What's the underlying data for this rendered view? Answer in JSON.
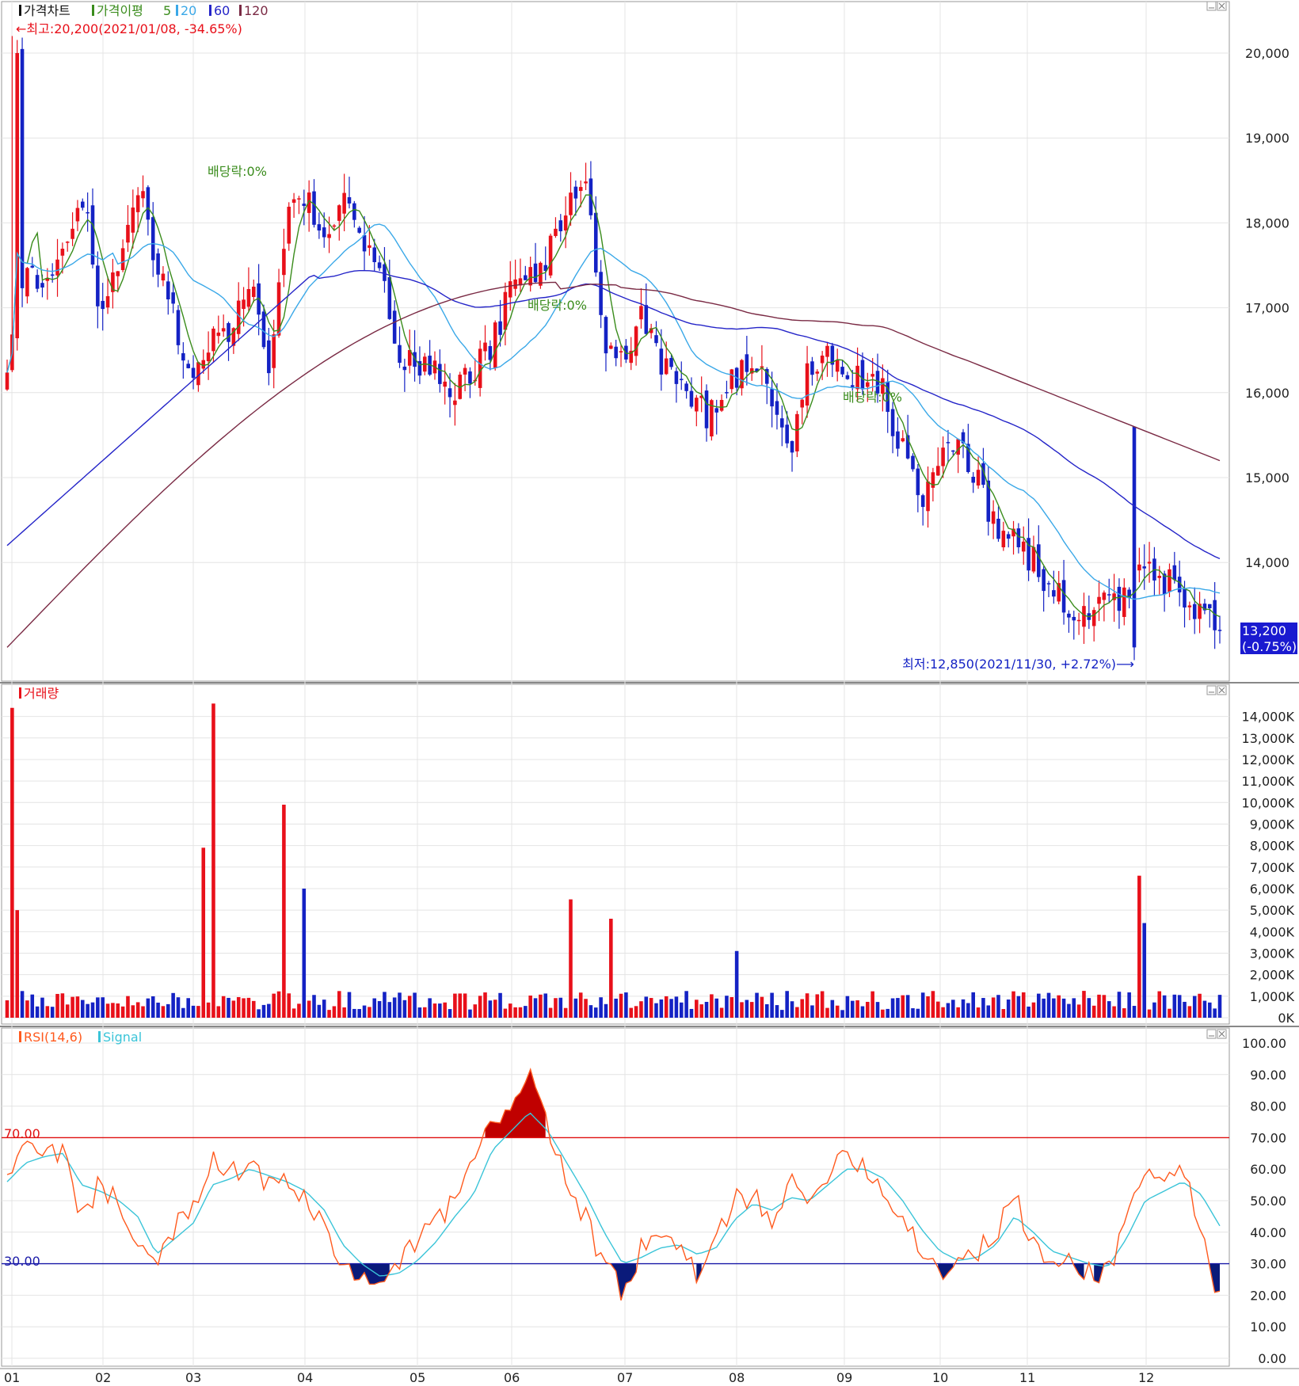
{
  "colors": {
    "up": "#e8101a",
    "down": "#1422c4",
    "ma5": "#3a8c1c",
    "ma20": "#3aa8e8",
    "ma60": "#2424c8",
    "ma120": "#7a2a44",
    "rsi": "#ff5a1e",
    "signal": "#3ac4d8",
    "overbought": "#e01010",
    "oversold": "#1a1aa8",
    "rsi_fill_high": "#c00000",
    "rsi_fill_low": "#0a1a7a",
    "grid": "#e4e4e4",
    "panel_border": "#9a9a9a",
    "last_price_box": "#1a1ad0"
  },
  "price_panel": {
    "legend_title": "가격차트",
    "legend_ma_label": "가격이평",
    "ma_periods": [
      "5",
      "20",
      "60",
      "120"
    ],
    "high_annotation": "←최고:20,200(2021/01/08, -34.65%)",
    "low_annotation": "최저:12,850(2021/11/30, +2.72%)⟶",
    "last_price": "13,200",
    "last_change": "(-0.75%)",
    "y_ticks": [
      "20,000",
      "19,000",
      "18,000",
      "17,000",
      "16,000",
      "15,000",
      "14,000"
    ],
    "dividend_labels": [
      "배당락:0%",
      "배당락:0%",
      "배당락:0%"
    ]
  },
  "volume_panel": {
    "legend": "거래량",
    "y_ticks": [
      "14,000K",
      "13,000K",
      "12,000K",
      "11,000K",
      "10,000K",
      "9,000K",
      "8,000K",
      "7,000K",
      "6,000K",
      "5,000K",
      "4,000K",
      "3,000K",
      "2,000K",
      "1,000K",
      "0K"
    ]
  },
  "rsi_panel": {
    "legend_rsi": "RSI(14,6)",
    "legend_signal": "Signal",
    "level_high": "70.00",
    "level_low": "30.00",
    "y_ticks": [
      "100.00",
      "90.00",
      "80.00",
      "70.00",
      "60.00",
      "50.00",
      "40.00",
      "30.00",
      "20.00",
      "10.00",
      "0.00"
    ]
  },
  "x_axis": {
    "months": [
      "01",
      "02",
      "03",
      "04",
      "05",
      "06",
      "07",
      "08",
      "09",
      "10",
      "11",
      "12"
    ]
  },
  "chart_data": [
    {
      "type": "candlestick",
      "title": "가격차트",
      "ylim": [
        12700,
        20700
      ],
      "anchor_closes": [
        16200,
        17600,
        17200,
        17700,
        18400,
        17000,
        17600,
        18500,
        17500,
        16800,
        16100,
        16700,
        16800,
        17300,
        16200,
        18100,
        18400,
        17800,
        18200,
        17900,
        17400,
        16500,
        16200,
        16300,
        16000,
        16200,
        16600,
        17200,
        17400,
        17600,
        18300,
        18600,
        16600,
        16500,
        16900,
        16300,
        16100,
        15800,
        15700,
        16200,
        16400,
        15900,
        15400,
        16300,
        16500,
        16100,
        16200,
        16000,
        15300,
        14800,
        15200,
        15500,
        15000,
        14400,
        14300,
        14000,
        13700,
        13400,
        13300,
        13500,
        13600,
        14000,
        13800,
        13600,
        13400,
        13200
      ],
      "high": {
        "value": 20200,
        "date": "2021/01/08"
      },
      "low": {
        "value": 12850,
        "date": "2021/11/30"
      },
      "last": 13200,
      "ma_periods": [
        5,
        20,
        60,
        120
      ],
      "ma120_endpoints": [
        13000,
        15200
      ]
    },
    {
      "type": "bar",
      "title": "거래량",
      "unit": "K",
      "ylim": [
        0,
        14500
      ],
      "spikes": [
        {
          "month_pos": 0.06,
          "value": 14400
        },
        {
          "month_pos": 0.09,
          "value": 5000
        },
        {
          "month_pos": 1.9,
          "value": 7900
        },
        {
          "month_pos": 1.98,
          "value": 14600
        },
        {
          "month_pos": 2.7,
          "value": 9900
        },
        {
          "month_pos": 2.9,
          "value": 6000
        },
        {
          "month_pos": 5.45,
          "value": 5500
        },
        {
          "month_pos": 5.85,
          "value": 4600
        },
        {
          "month_pos": 7.05,
          "value": 3100
        },
        {
          "month_pos": 10.95,
          "value": 6600
        },
        {
          "month_pos": 11.0,
          "value": 4400
        }
      ]
    },
    {
      "type": "line",
      "title": "RSI(14,6)",
      "ylim": [
        0,
        100
      ],
      "levels": [
        70,
        30
      ],
      "rsi_anchors": [
        55,
        68,
        63,
        67,
        45,
        55,
        50,
        38,
        27,
        42,
        47,
        62,
        58,
        63,
        55,
        55,
        50,
        40,
        30,
        25,
        22,
        30,
        38,
        42,
        52,
        60,
        75,
        82,
        90,
        74,
        55,
        44,
        30,
        20,
        35,
        38,
        35,
        25,
        38,
        50,
        52,
        45,
        55,
        48,
        60,
        67,
        60,
        53,
        45,
        35,
        27,
        32,
        33,
        40,
        52,
        35,
        30,
        30,
        28,
        27,
        45,
        60,
        55,
        62,
        40,
        19
      ],
      "signal_anchors": [
        56,
        62,
        64,
        65,
        55,
        53,
        50,
        45,
        33,
        38,
        43,
        55,
        57,
        60,
        58,
        56,
        53,
        47,
        36,
        30,
        26,
        27,
        31,
        37,
        45,
        52,
        66,
        72,
        78,
        72,
        62,
        52,
        40,
        30,
        32,
        35,
        36,
        33,
        35,
        44,
        49,
        47,
        51,
        50,
        55,
        60,
        60,
        57,
        50,
        41,
        34,
        31,
        32,
        36,
        45,
        40,
        34,
        32,
        30,
        29,
        38,
        50,
        53,
        56,
        52,
        42
      ]
    }
  ]
}
